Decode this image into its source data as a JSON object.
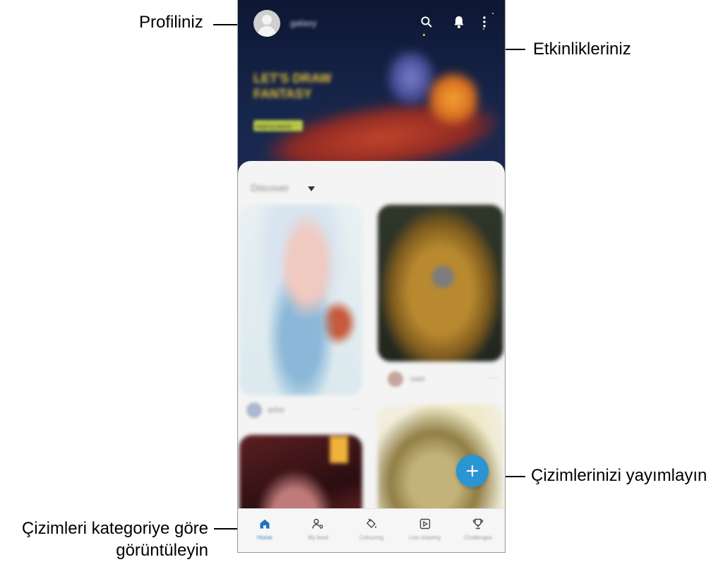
{
  "callouts": {
    "profile": "Profiliniz",
    "activities": "Etkinlikleriniz",
    "publish": "Çizimlerinizi yayımlayın",
    "browse_line1": "Çizimleri kategoriye göre",
    "browse_line2": "görüntüleyin"
  },
  "topbar": {
    "username": "galaxy",
    "icons": [
      "search-icon",
      "bell-icon",
      "more-options-icon"
    ]
  },
  "hero": {
    "title": "LET'S DRAW FANTASY",
    "button": "PARTICIPATE"
  },
  "content": {
    "category": "Discover",
    "cards": [
      {
        "author": "artist",
        "image": "girl-portrait-illustration"
      },
      {
        "author": "user",
        "image": "teddy-bear-drawing"
      },
      {
        "author": "",
        "image": "dark-red-illustration"
      },
      {
        "author": "",
        "image": "golden-dragon-illustration"
      }
    ]
  },
  "fab": {
    "icon": "plus-icon"
  },
  "bottom_nav": {
    "items": [
      {
        "label": "Home",
        "icon": "home-icon",
        "active": true
      },
      {
        "label": "My feed",
        "icon": "people-icon",
        "active": false
      },
      {
        "label": "Colouring",
        "icon": "paint-bucket-icon",
        "active": false
      },
      {
        "label": "Live drawing",
        "icon": "play-icon",
        "active": false
      },
      {
        "label": "Challenges",
        "icon": "trophy-icon",
        "active": false
      }
    ]
  },
  "colors": {
    "accent": "#2b95d3",
    "active_nav": "#2a7fc6",
    "hero_bg": "#0e1733"
  }
}
